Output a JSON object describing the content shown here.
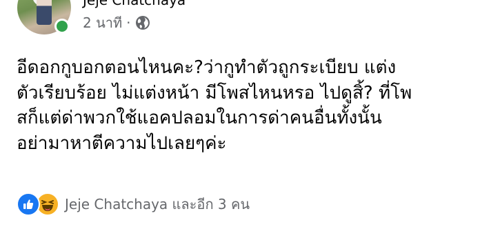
{
  "post": {
    "author_name": "Jeje Chatchaya",
    "time": "2 นาที",
    "separator": "·",
    "privacy_icon": "globe-icon",
    "text_lines": [
      "อีดอกกูบอกตอนไหนคะ?ว่ากูทำตัวถูกระเบียบ แต่ง",
      "ตัวเรียบร้อย ไม่แต่งหน้า มีโพสไหนหรอ ไปดูสิ้? ที่โพ",
      "สก็แต่ด่าพวกใช้แอคปลอมในการด่าคนอื่นทั้งนั้น",
      "อย่ามาหาตีความไปเลยๆค่ะ"
    ]
  },
  "reactions": {
    "icons": [
      "like-icon",
      "haha-icon"
    ],
    "summary": "Jeje Chatchaya และอีก 3 คน"
  },
  "colors": {
    "like": "#1877f2",
    "haha": "#f7b125",
    "online": "#31a24c",
    "secondary_text": "#65676b"
  }
}
